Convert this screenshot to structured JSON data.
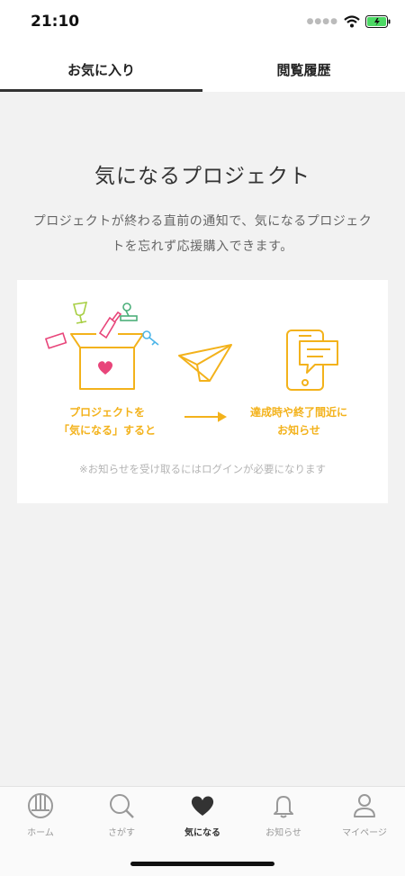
{
  "status_bar": {
    "time": "21:10"
  },
  "tabs": [
    {
      "label": "お気に入り",
      "active": true
    },
    {
      "label": "閲覧履歴",
      "active": false
    }
  ],
  "main": {
    "title": "気になるプロジェクト",
    "description": "プロジェクトが終わる直前の通知で、気になるプロジェクトを忘れず応援購入できます。"
  },
  "card": {
    "caption_left_line1": "プロジェクトを",
    "caption_left_line2": "「気になる」すると",
    "caption_right_line1": "達成時や終了間近に",
    "caption_right_line2": "お知らせ",
    "note": "※お知らせを受け取るにはログインが必要になります"
  },
  "colors": {
    "accent_yellow": "#f3b21b",
    "heart_pink": "#e8457a",
    "active_dark": "#333333"
  },
  "bottom_nav": [
    {
      "label": "ホーム",
      "icon": "home-icon"
    },
    {
      "label": "さがす",
      "icon": "search-icon"
    },
    {
      "label": "気になる",
      "icon": "heart-icon",
      "active": true
    },
    {
      "label": "お知らせ",
      "icon": "bell-icon"
    },
    {
      "label": "マイページ",
      "icon": "person-icon"
    }
  ]
}
